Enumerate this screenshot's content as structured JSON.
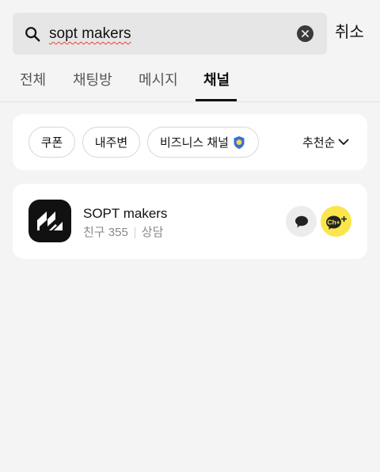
{
  "search": {
    "query": "sopt makers",
    "cancel_label": "취소"
  },
  "tabs": [
    {
      "label": "전체",
      "active": false
    },
    {
      "label": "채팅방",
      "active": false
    },
    {
      "label": "메시지",
      "active": false
    },
    {
      "label": "채널",
      "active": true
    }
  ],
  "filters": {
    "chips": [
      {
        "label": "쿠폰"
      },
      {
        "label": "내주변"
      },
      {
        "label": "비즈니스 채널"
      }
    ],
    "sort_label": "추천순"
  },
  "channel": {
    "name": "SOPT makers",
    "friends": "친구 355",
    "consult": "상담",
    "add_badge": "Ch+"
  },
  "icons": {
    "search": "search-icon",
    "clear": "clear-icon",
    "verified": "shield-icon",
    "sort": "chevron-down-icon",
    "chat": "chat-bubble-icon",
    "add_channel": "channel-add-icon"
  },
  "colors": {
    "background": "#f4f4f4",
    "card": "#ffffff",
    "accent_yellow": "#fae64c",
    "verified_blue": "#3b6fd8"
  }
}
